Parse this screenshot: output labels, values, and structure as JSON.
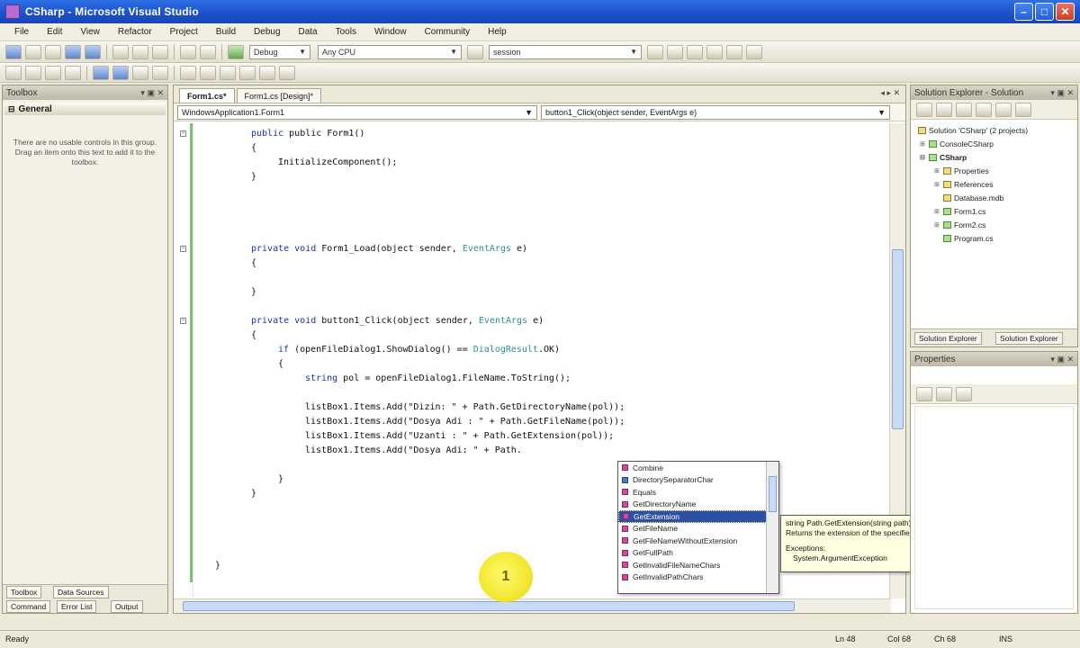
{
  "window": {
    "title": "CSharp - Microsoft Visual Studio",
    "colors": {
      "titlebar": "#2f6fe6",
      "selection": "#2f4fa2",
      "marker": "#f1e62c"
    }
  },
  "menu": [
    "File",
    "Edit",
    "View",
    "Refactor",
    "Project",
    "Build",
    "Debug",
    "Data",
    "Tools",
    "Window",
    "Community",
    "Help"
  ],
  "toolbar": {
    "config": "Debug",
    "platform": "Any CPU",
    "find": "session"
  },
  "toolbox": {
    "title": "Toolbox",
    "group": "General",
    "message": "There are no usable controls in this group. Drag an item onto this text to add it to the toolbox.",
    "tabs": [
      "Toolbox",
      "Data Sources"
    ],
    "tabs2": [
      "Command",
      "Error List",
      "Output"
    ]
  },
  "editor": {
    "tabs": [
      "Form1.cs*",
      "Form1.cs [Design]*"
    ],
    "nav_left": "WindowsApplication1.Form1",
    "nav_right": "button1_Click(object sender, EventArgs e)",
    "lines": {
      "l1": "public Form1()",
      "l2": "{",
      "l3": "InitializeComponent();",
      "l4": "}",
      "l5_kw": "private void ",
      "l5_rest": "Form1_Load(object sender, ",
      "l5_ty": "EventArgs",
      "l5_end": " e)",
      "l6": "{",
      "l7": "}",
      "l8_kw": "private void ",
      "l8_rest": "button1_Click(object sender, ",
      "l8_ty": "EventArgs",
      "l8_end": " e)",
      "l9": "{",
      "l10_kw": "if ",
      "l10_rest": "(openFileDialog1.ShowDialog() == ",
      "l10_ty": "DialogResult",
      "l10_end": ".OK)",
      "l11": "{",
      "l12_kw": "string ",
      "l12_rest": "pol = openFileDialog1.FileName.ToString();",
      "l13": "listBox1.Items.Add(\"Dizin: \" + Path.GetDirectoryName(pol));",
      "l14": "listBox1.Items.Add(\"Dosya Adi : \" + Path.GetFileName(pol));",
      "l15": "listBox1.Items.Add(\"Uzanti : \" + Path.GetExtension(pol));",
      "l16": "listBox1.Items.Add(\"Dosya Adi: \" + Path.",
      "l17": "}",
      "l18": "}",
      "l19": "}"
    }
  },
  "intellisense": {
    "items": [
      "Combine",
      "DirectorySeparatorChar",
      "Equals",
      "GetDirectoryName",
      "GetExtension",
      "GetFileName",
      "GetFileNameWithoutExtension",
      "GetFullPath",
      "GetInvalidFileNameChars",
      "GetInvalidPathChars"
    ],
    "selected_index": 4
  },
  "tooltip": {
    "signature": "string Path.GetExtension(string path)",
    "summary": "Returns the extension of the specified path string.",
    "exceptions_label": "Exceptions:",
    "exception": "System.ArgumentException"
  },
  "marker": {
    "label": "1"
  },
  "solution_explorer": {
    "title": "Solution Explorer - Solution",
    "items": [
      "Solution 'CSharp' (2 projects)",
      "ConsoleCSharp",
      "CSharp",
      "Properties",
      "References",
      "Database.mdb",
      "Form1.cs",
      "Form2.cs",
      "Program.cs"
    ],
    "tabs": [
      "Solution Explorer",
      "Solution Explorer"
    ]
  },
  "properties": {
    "title": "Properties"
  },
  "statusbar": {
    "ready": "Ready",
    "ln": "Ln 48",
    "col": "Col 68",
    "ch": "Ch 68",
    "ins": "INS"
  }
}
